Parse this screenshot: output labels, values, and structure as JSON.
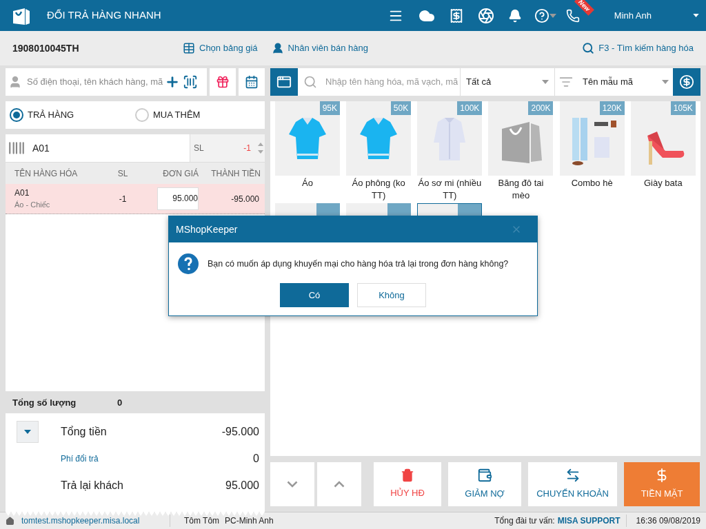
{
  "app": {
    "title": "ĐỔI TRẢ HÀNG NHANH",
    "user": "Minh Anh",
    "new_badge": "New"
  },
  "subbar": {
    "order_no": "1908010045TH",
    "price_list": "Chọn bảng giá",
    "staff": "Nhân viên bán hàng",
    "search": "F3 - Tìm kiếm hàng hóa"
  },
  "customer": {
    "placeholder": "Số điện thoại, tên khách hàng, mã"
  },
  "modes": [
    {
      "label": "TRẢ HÀNG",
      "selected": true
    },
    {
      "label": "MUA THÊM",
      "selected": false
    }
  ],
  "barcode": {
    "value": "A01",
    "qty_label": "SL",
    "qty": "-1"
  },
  "cart": {
    "columns": [
      "TÊN HÀNG HÓA",
      "SL",
      "ĐƠN GIÁ",
      "THÀNH TIỀN"
    ],
    "rows": [
      {
        "code": "A01",
        "desc": "Áo - Chiếc",
        "qty": "-1",
        "price": "95.000",
        "total": "-95.000",
        "selected": true
      }
    ]
  },
  "summary": {
    "qty_label": "Tổng số lượng",
    "qty": "0",
    "lines": [
      {
        "label": "Tổng tiền",
        "value": "-95.000",
        "kind": "main"
      },
      {
        "label": "Phí đổi trả",
        "value": "0",
        "kind": "link"
      },
      {
        "label": "Trả lại khách",
        "value": "95.000",
        "kind": "main"
      }
    ]
  },
  "products_toolbar": {
    "placeholder": "Nhập tên hàng hóa, mã vạch, mã",
    "category": "Tất cả",
    "sort": "Tên mẫu mã"
  },
  "products": [
    {
      "name": "Áo",
      "price": "95K"
    },
    {
      "name": "Áo phông (ko TT)",
      "price": "50K"
    },
    {
      "name": "Áo sơ mi (nhiều TT)",
      "price": "100K"
    },
    {
      "name": "Băng đô tai mèo",
      "price": "200K"
    },
    {
      "name": "Combo hè",
      "price": "120K"
    },
    {
      "name": "Giày bata",
      "price": "105K"
    }
  ],
  "covered_products": [
    {
      "selected": false
    },
    {
      "selected": false
    },
    {
      "selected": true
    }
  ],
  "actions": [
    {
      "label": "HỦY HĐ",
      "kind": "cancel"
    },
    {
      "label": "GIẢM NỢ",
      "kind": "debt"
    },
    {
      "label": "CHUYỂN KHOẢN",
      "kind": "transfer"
    },
    {
      "label": "TIỀN MẶT",
      "kind": "cash"
    }
  ],
  "status_bar": {
    "site": "tomtest.mshopkeeper.misa.local",
    "user": "Tôm Tôm",
    "pc": "PC-Minh Anh",
    "hotline_label": "Tổng đài tư vấn:",
    "hotline": "MISA SUPPORT",
    "datetime": "16:36 09/08/2019"
  },
  "dialog": {
    "title": "MShopKeeper",
    "message": "Bạn có muốn áp dụng khuyến mại cho hàng hóa trả lại trong đơn hàng không?",
    "buttons": [
      {
        "label": "Có",
        "selected": true
      },
      {
        "label": "Không",
        "selected": false
      }
    ]
  }
}
